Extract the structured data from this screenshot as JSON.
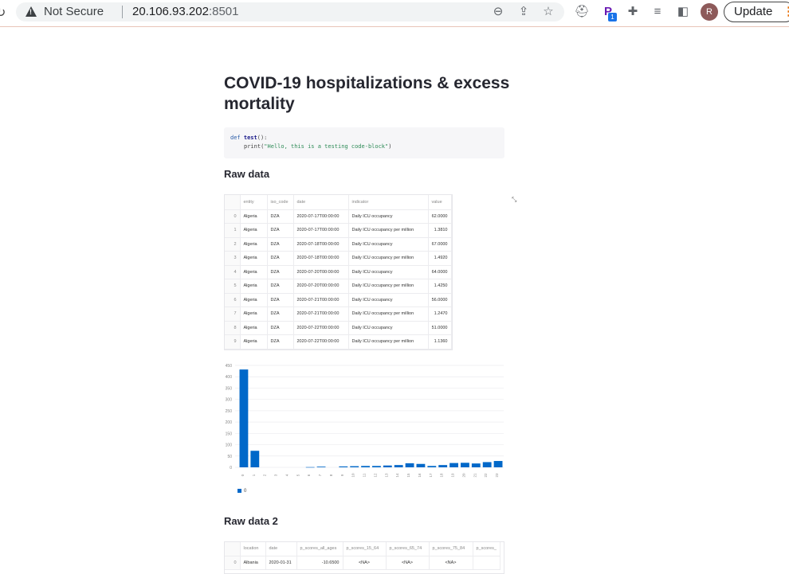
{
  "browser": {
    "security_label": "Not Secure",
    "url_host": "20.106.93.202",
    "url_port": ":8501",
    "update_label": "Update",
    "avatar_letter": "R",
    "badge_count": "1"
  },
  "page": {
    "title": "COVID-19 hospitalizations & excess mortality",
    "code_line1_kw": "def",
    "code_line1_fn": "test",
    "code_line1_rest": "():",
    "code_line2_fn": "print",
    "code_line2_str": "\"Hello, this is a testing code-block\"",
    "section1": "Raw data",
    "section2": "Raw data 2"
  },
  "table1": {
    "columns": [
      "",
      "entity",
      "iso_code",
      "date",
      "indicator",
      "value"
    ],
    "rows": [
      [
        "0",
        "Algeria",
        "DZA",
        "2020-07-17T00:00:00",
        "Daily ICU occupancy",
        "62.0000"
      ],
      [
        "1",
        "Algeria",
        "DZA",
        "2020-07-17T00:00:00",
        "Daily ICU occupancy per million",
        "1.3810"
      ],
      [
        "2",
        "Algeria",
        "DZA",
        "2020-07-18T00:00:00",
        "Daily ICU occupancy",
        "67.0000"
      ],
      [
        "3",
        "Algeria",
        "DZA",
        "2020-07-18T00:00:00",
        "Daily ICU occupancy per million",
        "1.4920"
      ],
      [
        "4",
        "Algeria",
        "DZA",
        "2020-07-20T00:00:00",
        "Daily ICU occupancy",
        "64.0000"
      ],
      [
        "5",
        "Algeria",
        "DZA",
        "2020-07-20T00:00:00",
        "Daily ICU occupancy per million",
        "1.4250"
      ],
      [
        "6",
        "Algeria",
        "DZA",
        "2020-07-21T00:00:00",
        "Daily ICU occupancy",
        "56.0000"
      ],
      [
        "7",
        "Algeria",
        "DZA",
        "2020-07-21T00:00:00",
        "Daily ICU occupancy per million",
        "1.2470"
      ],
      [
        "8",
        "Algeria",
        "DZA",
        "2020-07-22T00:00:00",
        "Daily ICU occupancy",
        "51.0000"
      ],
      [
        "9",
        "Algeria",
        "DZA",
        "2020-07-22T00:00:00",
        "Daily ICU occupancy per million",
        "1.1360"
      ]
    ]
  },
  "table2": {
    "columns": [
      "",
      "location",
      "date",
      "p_scores_all_ages",
      "p_scores_15_64",
      "p_scores_65_74",
      "p_scores_75_84",
      "p_scores_"
    ],
    "rows": [
      [
        "0",
        "Albania",
        "2020-01-31",
        "-10.6500",
        "<NA>",
        "<NA>",
        "<NA>",
        ""
      ]
    ]
  },
  "chart_data": {
    "type": "bar",
    "categories": [
      "0",
      "1",
      "2",
      "3",
      "4",
      "5",
      "6",
      "7",
      "8",
      "9",
      "10",
      "11",
      "12",
      "13",
      "14",
      "15",
      "16",
      "17",
      "18",
      "19",
      "20",
      "21",
      "22",
      "23"
    ],
    "series": [
      {
        "name": "0",
        "values": [
          432,
          73,
          0,
          0,
          0,
          0,
          1,
          3,
          0,
          4,
          5,
          6,
          6,
          8,
          10,
          18,
          15,
          6,
          10,
          19,
          20,
          17,
          23,
          28
        ]
      }
    ],
    "ylim": [
      0,
      450
    ],
    "yticks": [
      "450",
      "400",
      "350",
      "300",
      "250",
      "200",
      "150",
      "100",
      "50",
      "0"
    ],
    "color": "#0068c9",
    "legend_position": "bottom-left",
    "grid": true
  }
}
